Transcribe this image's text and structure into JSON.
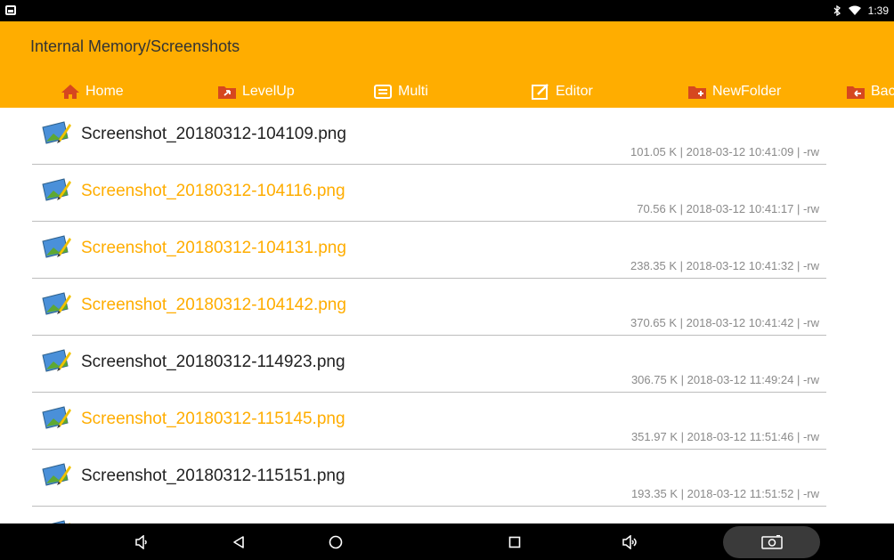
{
  "status_bar": {
    "time": "1:39"
  },
  "app_bar": {
    "path": "Internal Memory/Screenshots",
    "toolbar": [
      {
        "label": "Home",
        "icon": "home-icon"
      },
      {
        "label": "LevelUp",
        "icon": "levelup-icon"
      },
      {
        "label": "Multi",
        "icon": "multi-icon"
      },
      {
        "label": "Editor",
        "icon": "editor-icon"
      },
      {
        "label": "NewFolder",
        "icon": "new-folder-icon"
      },
      {
        "label": "Bac",
        "icon": "back-folder-icon"
      }
    ]
  },
  "colors": {
    "accent": "#ffad00",
    "selected_text": "#ffad00",
    "meta_text": "#8a8a8a"
  },
  "files": [
    {
      "name": "Screenshot_20180312-104109.png",
      "meta": "101.05 K | 2018-03-12 10:41:09 | -rw",
      "selected": false
    },
    {
      "name": "Screenshot_20180312-104116.png",
      "meta": "70.56 K | 2018-03-12 10:41:17 | -rw",
      "selected": true
    },
    {
      "name": "Screenshot_20180312-104131.png",
      "meta": "238.35 K | 2018-03-12 10:41:32 | -rw",
      "selected": true
    },
    {
      "name": "Screenshot_20180312-104142.png",
      "meta": "370.65 K | 2018-03-12 10:41:42 | -rw",
      "selected": true
    },
    {
      "name": "Screenshot_20180312-114923.png",
      "meta": "306.75 K | 2018-03-12 11:49:24 | -rw",
      "selected": false
    },
    {
      "name": "Screenshot_20180312-115145.png",
      "meta": "351.97 K | 2018-03-12 11:51:46 | -rw",
      "selected": true
    },
    {
      "name": "Screenshot_20180312-115151.png",
      "meta": "193.35 K | 2018-03-12 11:51:52 | -rw",
      "selected": false
    }
  ],
  "nav_bar": [
    "volume-down-icon",
    "back-icon",
    "home-circle-icon",
    "recents-icon",
    "volume-up-icon",
    "screenshot-icon"
  ]
}
